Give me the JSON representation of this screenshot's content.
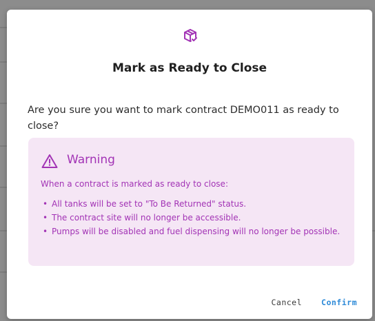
{
  "dialog": {
    "header_icon": "package-check-icon",
    "title": "Mark as Ready to Close",
    "message": "Are you sure you want to mark contract DEMO011 as ready to close?"
  },
  "warning": {
    "icon": "warning-triangle-icon",
    "title": "Warning",
    "intro": "When a contract is marked as ready to close:",
    "items": [
      "All tanks will be set to \"To Be Returned\" status.",
      "The contract site will no longer be accessible.",
      "Pumps will be disabled and fuel dispensing will no longer be possible."
    ]
  },
  "actions": {
    "cancel_label": "Cancel",
    "confirm_label": "Confirm"
  },
  "colors": {
    "accent": "#a233b5",
    "warning_bg": "#f5e6f5",
    "confirm": "#2d8ad8"
  }
}
